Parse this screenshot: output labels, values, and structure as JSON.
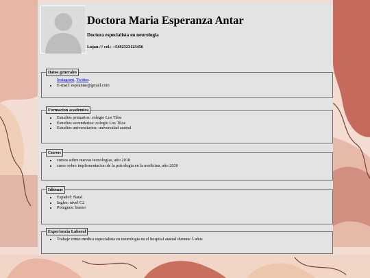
{
  "profile": {
    "name": "Doctora Maria Esperanza Antar",
    "subtitle": "Doctora especialista en neurologia",
    "contact": "Lujan /// cel.: +5492323123456"
  },
  "sections": {
    "general": {
      "title": "Datos generales",
      "link1": "Instagram",
      "sep": ", ",
      "link2": "Twitter",
      "dot": ".",
      "email": "E-mail: espeantar@gmail.com"
    },
    "education": {
      "title": "Formacion academica",
      "items": [
        "Estudios primarios: colegio Los Tilos",
        "Estudios secundarios: colegio Los Tilos",
        "Estudios universitarios: universidad austral"
      ]
    },
    "courses": {
      "title": "Cursos",
      "items": [
        "cursos sobre nuevas tecnologias, año 2018",
        "curso sobre implementacion de la psicologia en la medicina, año 2020"
      ]
    },
    "languages": {
      "title": "Idiomas",
      "items": [
        "Español: Natal",
        "Ingles: nivel C2",
        "Potugues: bueno"
      ]
    },
    "experience": {
      "title": "Experiencia Laboral",
      "items": [
        "Trabaje como medica especialista en neurologia en el hospital austral durante 5 años"
      ]
    }
  },
  "colors": {
    "background": "#f3ddd3",
    "panel": "#e4e3e3",
    "shape_terracotta": "#c66b5c",
    "shape_rose": "#e0b2a5",
    "shape_sand": "#edc9a9",
    "line": "#7a3f33",
    "link": "#0000ee"
  },
  "icons": {
    "avatar": "user-silhouette-icon"
  }
}
